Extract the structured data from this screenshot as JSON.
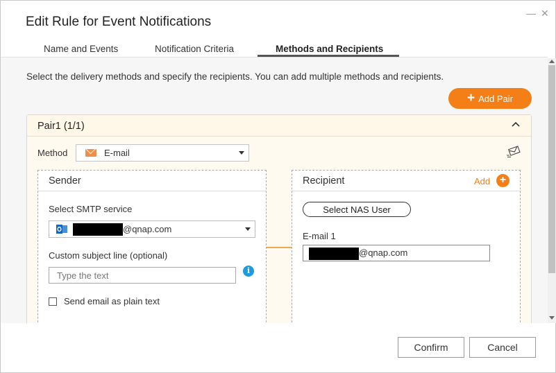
{
  "dialog": {
    "title": "Edit Rule for Event Notifications",
    "minimize_glyph": "—",
    "close_glyph": "✕"
  },
  "tabs": [
    {
      "label": "Name and Events",
      "active": false
    },
    {
      "label": "Notification Criteria",
      "active": false
    },
    {
      "label": "Methods and Recipients",
      "active": true
    }
  ],
  "intro_text": "Select the delivery methods and specify the recipients. You can add multiple methods and recipients.",
  "add_pair_label": "Add Pair",
  "pair": {
    "title": "Pair1 (1/1)",
    "method_label": "Method",
    "method_value": "E-mail",
    "sender": {
      "title": "Sender",
      "smtp_label": "Select SMTP service",
      "smtp_value_suffix": "@qnap.com",
      "subject_label": "Custom subject line (optional)",
      "subject_placeholder": "Type the text",
      "plain_text_label": "Send email as plain text",
      "plain_text_checked": false
    },
    "recipient": {
      "title": "Recipient",
      "add_label": "Add",
      "select_nas_user_label": "Select NAS User",
      "email_label": "E-mail 1",
      "email_value_suffix": "@qnap.com"
    }
  },
  "footer": {
    "confirm_label": "Confirm",
    "cancel_label": "Cancel"
  },
  "colors": {
    "accent": "#f57f17",
    "info": "#1e9ae0",
    "outlook": "#1565c0"
  },
  "icons": [
    "minimize-icon",
    "close-icon",
    "plus-icon",
    "chevron-up-icon",
    "mail-icon",
    "dropdown-arrow-icon",
    "test-send-icon",
    "outlook-icon",
    "info-icon",
    "add-circle-icon"
  ]
}
